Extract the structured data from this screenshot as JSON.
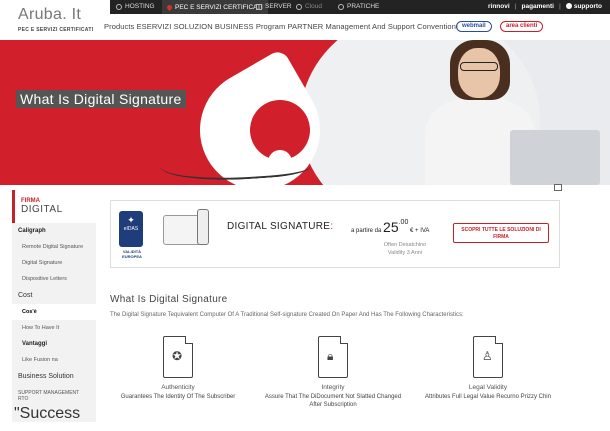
{
  "header": {
    "brand": "Aruba. It",
    "brand_sub": "PEC E SERVIZI CERTIFICATI",
    "top_nav": [
      "HOSTING",
      "PEC E SERVIZI CERTIFICATI",
      "SERVER",
      "Cloud",
      "PRATICHE"
    ],
    "right_links": [
      "rinnovi",
      "pagamenti",
      "supporto"
    ],
    "sub_nav": "Products ESERVIZI SOLUZION BUSINESS Program PARTNER Management And Support Convention!",
    "webmail": "webmail",
    "area_clienti": "area clienti"
  },
  "hero": {
    "title": "What Is Digital Signature"
  },
  "sidebar": {
    "head_small": "FIRMA",
    "head_big": "DIGITAL",
    "items": [
      "Caligraph",
      "Remote Digital Signature",
      "Digital Signature",
      "Dispositive Letters",
      "Cost",
      "Cos'è",
      "How To Have It",
      "Vantaggi",
      "Like Fusion na",
      "Business Solution",
      "SUPPORT MANAGEMENT RTO"
    ],
    "footer": "\"Success"
  },
  "product": {
    "badge_top": "eIDAS",
    "badge_bottom": "VALIDITÀ EUROPEA",
    "title": "DIGITAL SIGNATURE",
    "price_prefix": "a partire da",
    "price_int": "25",
    "price_dec": ".00",
    "price_suffix": "€ + IVA",
    "price_note": "Often Desatchino Validity 3 Anni",
    "cta": "SCOPRI TUTTE LE SOLUZIONI DI FIRMA"
  },
  "section": {
    "title": "What Is Digital Signature",
    "description": "The Digital Signature Tequivalent Computer Of A Traditional Self-signature Created On Paper And Has The Following Characteristics:"
  },
  "features": [
    {
      "icon": "ribbon-document-icon",
      "title": "Authenticity",
      "desc": "Guarantees The Identity Of The Subscriber"
    },
    {
      "icon": "lock-document-icon",
      "title": "Integrity",
      "desc": "Assure That The DiDocument Not Slatted Changed After Subscription"
    },
    {
      "icon": "person-document-icon",
      "title": "Legal Validity",
      "desc": "Attributes Full Legal Value Recurno Prizzy Chin"
    }
  ],
  "colors": {
    "brand_red": "#d21f2c",
    "nav_dark": "#232323",
    "link_blue": "#2b4d9c"
  }
}
